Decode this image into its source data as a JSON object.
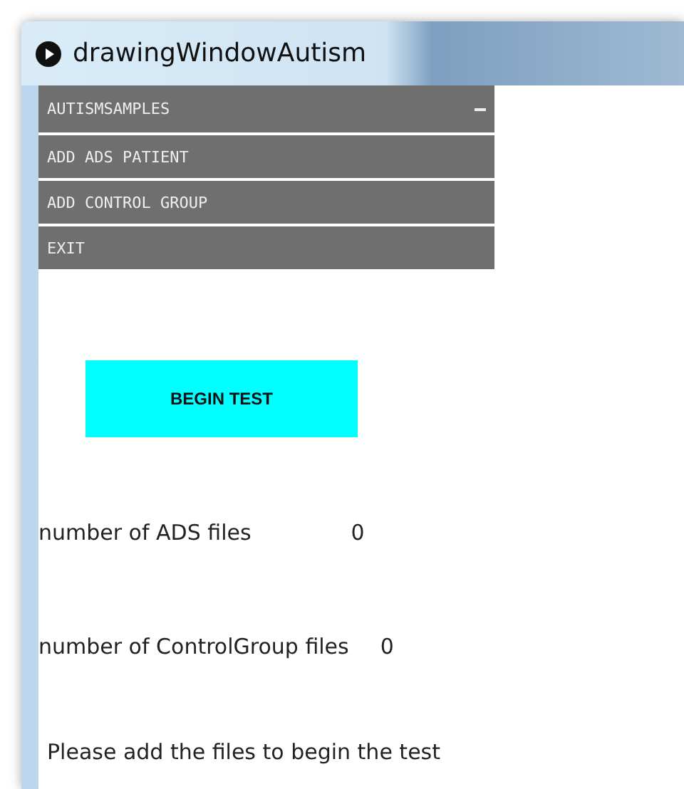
{
  "window": {
    "title": "drawingWindowAutism"
  },
  "menu": [
    {
      "label": "AUTISMSAMPLES",
      "kind": "dropdown"
    },
    {
      "label": "ADD ADS PATIENT",
      "kind": "item"
    },
    {
      "label": "ADD CONTROL GROUP",
      "kind": "item"
    },
    {
      "label": "EXIT",
      "kind": "item"
    }
  ],
  "begin_button": "BEGIN TEST",
  "counts": [
    {
      "label": "number of ADS files",
      "value": "0"
    },
    {
      "label": "number of ControlGroup files",
      "value": "0"
    }
  ],
  "message": "Please add the files to begin the test"
}
